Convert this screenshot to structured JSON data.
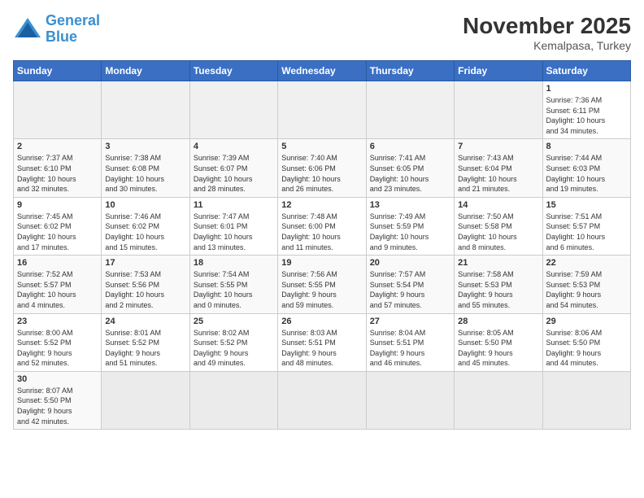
{
  "header": {
    "logo_general": "General",
    "logo_blue": "Blue",
    "month": "November 2025",
    "location": "Kemalpasa, Turkey"
  },
  "weekdays": [
    "Sunday",
    "Monday",
    "Tuesday",
    "Wednesday",
    "Thursday",
    "Friday",
    "Saturday"
  ],
  "days": [
    {
      "num": "",
      "info": ""
    },
    {
      "num": "",
      "info": ""
    },
    {
      "num": "",
      "info": ""
    },
    {
      "num": "",
      "info": ""
    },
    {
      "num": "",
      "info": ""
    },
    {
      "num": "",
      "info": ""
    },
    {
      "num": "1",
      "info": "Sunrise: 7:36 AM\nSunset: 6:11 PM\nDaylight: 10 hours\nand 34 minutes."
    },
    {
      "num": "2",
      "info": "Sunrise: 7:37 AM\nSunset: 6:10 PM\nDaylight: 10 hours\nand 32 minutes."
    },
    {
      "num": "3",
      "info": "Sunrise: 7:38 AM\nSunset: 6:08 PM\nDaylight: 10 hours\nand 30 minutes."
    },
    {
      "num": "4",
      "info": "Sunrise: 7:39 AM\nSunset: 6:07 PM\nDaylight: 10 hours\nand 28 minutes."
    },
    {
      "num": "5",
      "info": "Sunrise: 7:40 AM\nSunset: 6:06 PM\nDaylight: 10 hours\nand 26 minutes."
    },
    {
      "num": "6",
      "info": "Sunrise: 7:41 AM\nSunset: 6:05 PM\nDaylight: 10 hours\nand 23 minutes."
    },
    {
      "num": "7",
      "info": "Sunrise: 7:43 AM\nSunset: 6:04 PM\nDaylight: 10 hours\nand 21 minutes."
    },
    {
      "num": "8",
      "info": "Sunrise: 7:44 AM\nSunset: 6:03 PM\nDaylight: 10 hours\nand 19 minutes."
    },
    {
      "num": "9",
      "info": "Sunrise: 7:45 AM\nSunset: 6:02 PM\nDaylight: 10 hours\nand 17 minutes."
    },
    {
      "num": "10",
      "info": "Sunrise: 7:46 AM\nSunset: 6:02 PM\nDaylight: 10 hours\nand 15 minutes."
    },
    {
      "num": "11",
      "info": "Sunrise: 7:47 AM\nSunset: 6:01 PM\nDaylight: 10 hours\nand 13 minutes."
    },
    {
      "num": "12",
      "info": "Sunrise: 7:48 AM\nSunset: 6:00 PM\nDaylight: 10 hours\nand 11 minutes."
    },
    {
      "num": "13",
      "info": "Sunrise: 7:49 AM\nSunset: 5:59 PM\nDaylight: 10 hours\nand 9 minutes."
    },
    {
      "num": "14",
      "info": "Sunrise: 7:50 AM\nSunset: 5:58 PM\nDaylight: 10 hours\nand 8 minutes."
    },
    {
      "num": "15",
      "info": "Sunrise: 7:51 AM\nSunset: 5:57 PM\nDaylight: 10 hours\nand 6 minutes."
    },
    {
      "num": "16",
      "info": "Sunrise: 7:52 AM\nSunset: 5:57 PM\nDaylight: 10 hours\nand 4 minutes."
    },
    {
      "num": "17",
      "info": "Sunrise: 7:53 AM\nSunset: 5:56 PM\nDaylight: 10 hours\nand 2 minutes."
    },
    {
      "num": "18",
      "info": "Sunrise: 7:54 AM\nSunset: 5:55 PM\nDaylight: 10 hours\nand 0 minutes."
    },
    {
      "num": "19",
      "info": "Sunrise: 7:56 AM\nSunset: 5:55 PM\nDaylight: 9 hours\nand 59 minutes."
    },
    {
      "num": "20",
      "info": "Sunrise: 7:57 AM\nSunset: 5:54 PM\nDaylight: 9 hours\nand 57 minutes."
    },
    {
      "num": "21",
      "info": "Sunrise: 7:58 AM\nSunset: 5:53 PM\nDaylight: 9 hours\nand 55 minutes."
    },
    {
      "num": "22",
      "info": "Sunrise: 7:59 AM\nSunset: 5:53 PM\nDaylight: 9 hours\nand 54 minutes."
    },
    {
      "num": "23",
      "info": "Sunrise: 8:00 AM\nSunset: 5:52 PM\nDaylight: 9 hours\nand 52 minutes."
    },
    {
      "num": "24",
      "info": "Sunrise: 8:01 AM\nSunset: 5:52 PM\nDaylight: 9 hours\nand 51 minutes."
    },
    {
      "num": "25",
      "info": "Sunrise: 8:02 AM\nSunset: 5:52 PM\nDaylight: 9 hours\nand 49 minutes."
    },
    {
      "num": "26",
      "info": "Sunrise: 8:03 AM\nSunset: 5:51 PM\nDaylight: 9 hours\nand 48 minutes."
    },
    {
      "num": "27",
      "info": "Sunrise: 8:04 AM\nSunset: 5:51 PM\nDaylight: 9 hours\nand 46 minutes."
    },
    {
      "num": "28",
      "info": "Sunrise: 8:05 AM\nSunset: 5:50 PM\nDaylight: 9 hours\nand 45 minutes."
    },
    {
      "num": "29",
      "info": "Sunrise: 8:06 AM\nSunset: 5:50 PM\nDaylight: 9 hours\nand 44 minutes."
    },
    {
      "num": "30",
      "info": "Sunrise: 8:07 AM\nSunset: 5:50 PM\nDaylight: 9 hours\nand 42 minutes."
    },
    {
      "num": "",
      "info": ""
    },
    {
      "num": "",
      "info": ""
    },
    {
      "num": "",
      "info": ""
    },
    {
      "num": "",
      "info": ""
    },
    {
      "num": "",
      "info": ""
    },
    {
      "num": "",
      "info": ""
    }
  ]
}
